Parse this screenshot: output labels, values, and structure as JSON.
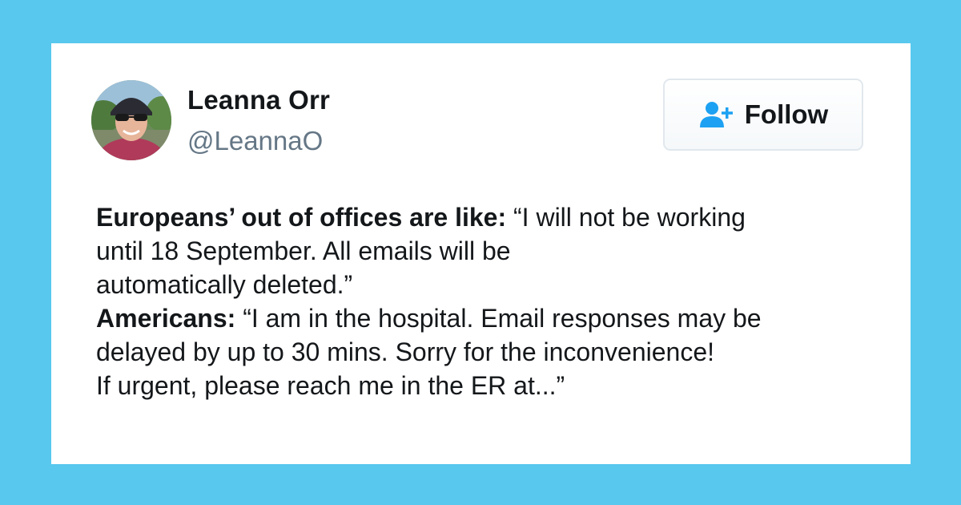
{
  "background_color": "#58c8ee",
  "user": {
    "name": "Leanna Orr",
    "handle": "@LeannaO",
    "avatar": "profile-photo"
  },
  "follow_button": {
    "icon": "add-user-icon",
    "label": "Follow",
    "accent_color": "#1da1f2"
  },
  "tweet": {
    "lines": [
      {
        "bold": "Europeans’ out of offices are like:",
        "text": " “I will not be working"
      },
      {
        "bold": "",
        "text": "until 18 September. All emails will be"
      },
      {
        "bold": "",
        "text": "automatically deleted.”"
      },
      {
        "bold": "Americans:",
        "text": " “I am in the hospital. Email responses may be"
      },
      {
        "bold": "",
        "text": "delayed by up to 30 mins. Sorry for the inconvenience!"
      },
      {
        "bold": "",
        "text": "If urgent, please reach me in the ER at...”"
      }
    ]
  }
}
